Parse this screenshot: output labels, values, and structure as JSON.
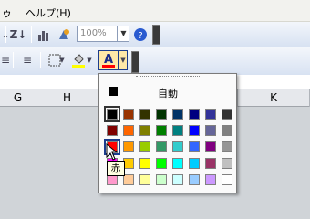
{
  "menubar": {
    "partial_item": "ゥ",
    "help": "ヘルプ(H)"
  },
  "toolbar": {
    "zoom_value": "100%"
  },
  "columns": [
    "G",
    "H",
    "K"
  ],
  "font_color_menu": {
    "automatic_label": "自動",
    "tooltip": "赤",
    "swatches": [
      [
        "#000000",
        "#993300",
        "#333300",
        "#003300",
        "#003366",
        "#000080",
        "#333399",
        "#333333"
      ],
      [
        "#800000",
        "#FF6600",
        "#808000",
        "#008000",
        "#008080",
        "#0000FF",
        "#666699",
        "#808080"
      ],
      [
        "#FF0000",
        "#FF9900",
        "#99CC00",
        "#339966",
        "#33CCCC",
        "#3366FF",
        "#800080",
        "#969696"
      ],
      [
        "#FF00FF",
        "#FFCC00",
        "#FFFF00",
        "#00FF00",
        "#00FFFF",
        "#00CCFF",
        "#993366",
        "#C0C0C0"
      ],
      [
        "#FF99CC",
        "#FFCC99",
        "#FFFF99",
        "#CCFFCC",
        "#CCFFFF",
        "#99CCFF",
        "#CC99FF",
        "#FFFFFF"
      ]
    ]
  },
  "colors": {
    "accent": "#1c3c8c",
    "toolbar": "#d8e2f2"
  }
}
